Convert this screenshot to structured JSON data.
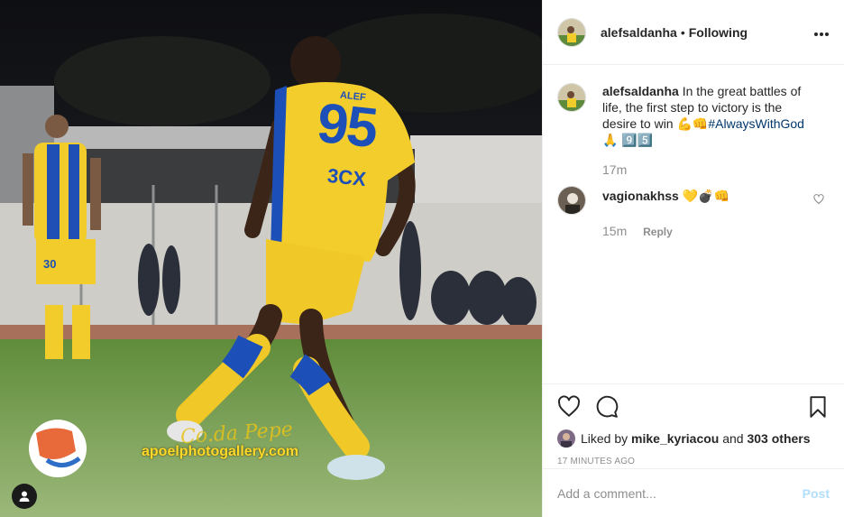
{
  "photo": {
    "jersey_name": "ALEF",
    "jersey_number": "95",
    "sponsor": "3CX",
    "short_number": "30",
    "watermark_signature": "Co.da Pepe",
    "watermark": "apoelphotogallery.com",
    "tag_icon": "user-silhouette-icon"
  },
  "header": {
    "username": "alefsaldanha",
    "separator": "•",
    "follow_status": "Following",
    "more_icon": "more-dots-icon"
  },
  "caption": {
    "username": "alefsaldanha",
    "text": "In the great battles of life, the first step to victory is the desire to win 💪👊",
    "hashtag": "#AlwaysWithGod",
    "tail": "🙏 9️⃣5️⃣",
    "time": "17m"
  },
  "comments": [
    {
      "username": "vagionakhss",
      "text": "💛💣👊",
      "time": "15m",
      "reply_label": "Reply"
    }
  ],
  "actions": {
    "like_icon": "heart-icon",
    "comment_icon": "comment-icon",
    "save_icon": "bookmark-icon"
  },
  "likes": {
    "prefix": "Liked by",
    "user": "mike_kyriacou",
    "middle": "and",
    "others": "303 others"
  },
  "timestamp": "17 MINUTES AGO",
  "add_comment": {
    "placeholder": "Add a comment...",
    "post_label": "Post"
  },
  "colors": {
    "link": "#00376b",
    "muted": "#8e8e8e",
    "post_disabled": "#b2dffc",
    "kit_yellow": "#f2cc2c",
    "kit_blue": "#1c4fb8"
  }
}
